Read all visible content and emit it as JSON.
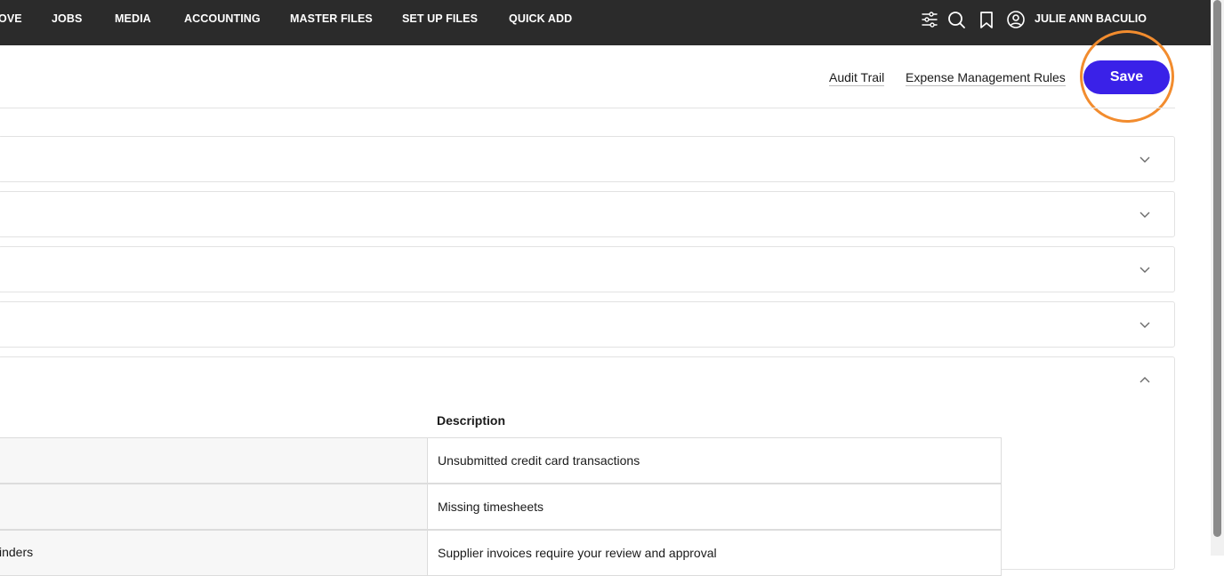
{
  "nav": {
    "items": [
      "OVE",
      "JOBS",
      "MEDIA",
      "ACCOUNTING",
      "MASTER FILES",
      "SET UP FILES",
      "QUICK ADD"
    ],
    "icons": [
      "filters-icon",
      "search-icon",
      "bookmark-icon",
      "user-icon"
    ],
    "user_name": "JULIE ANN BACULIO"
  },
  "header": {
    "audit_trail": "Audit Trail",
    "expense_rules": "Expense Management Rules",
    "save_label": "Save"
  },
  "colors": {
    "nav_bg": "#2b2b2b",
    "save_bg": "#3a21e8",
    "highlight_ring": "#f28c2e"
  },
  "table": {
    "column_header": "Description",
    "rows": [
      {
        "name": "",
        "description": "Unsubmitted credit card transactions"
      },
      {
        "name": "",
        "description": "Missing timesheets"
      },
      {
        "name": "inders",
        "description": "Supplier invoices require your review and approval"
      }
    ]
  }
}
